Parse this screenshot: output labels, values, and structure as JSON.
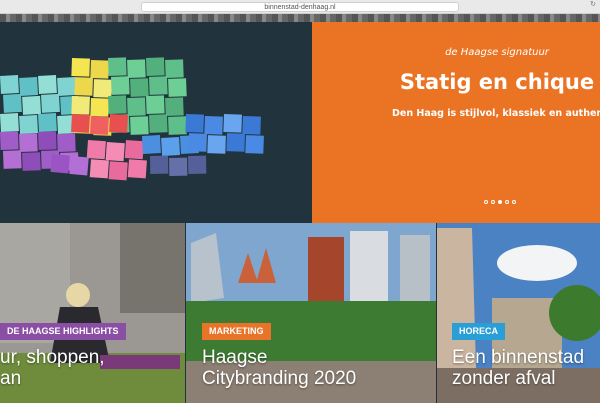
{
  "browser": {
    "url": "binnenstad-denhaag.nl"
  },
  "hero": {
    "kicker": "de Haagse signatuur",
    "title": "Statig en chique",
    "subtitle": "Den Haag is stijlvol, klassiek en authentiek",
    "slide_count": 5,
    "active_slide": 2
  },
  "cards": [
    {
      "tag": "DE HAAGSE HIGHLIGHTS",
      "title_line1": "ur, shoppen,",
      "title_line2": "an",
      "tag_color": "#8a4fa5"
    },
    {
      "tag": "MARKETING",
      "title_line1": "Haagse",
      "title_line2": "Citybranding 2020",
      "tag_color": "#e8742a"
    },
    {
      "tag": "HORECA",
      "title_line1": "Een binnenstad",
      "title_line2": "zonder afval",
      "tag_color": "#2a9fd6"
    }
  ],
  "colors": {
    "hero_orange": "#ea7424",
    "hero_dark": "#21343d"
  }
}
